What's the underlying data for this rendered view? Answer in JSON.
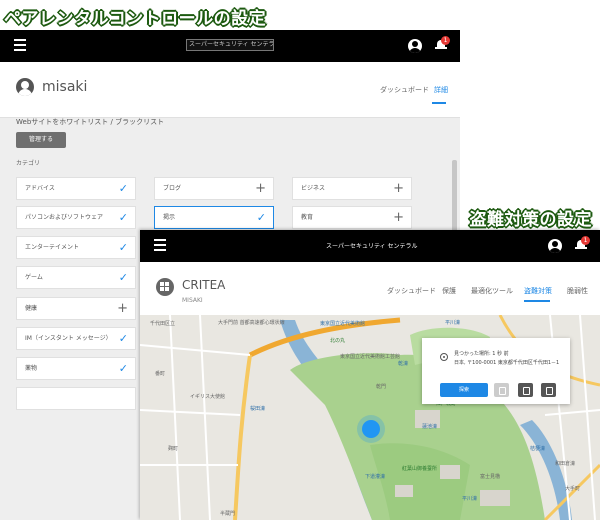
{
  "captions": {
    "parental": "ペアレンタルコントロールの設定",
    "antitheft": "盗難対策の設定"
  },
  "screen1": {
    "logo_alt": "スーパーセキュリティ センテラ",
    "notification_count": "1",
    "user_name": "misaki",
    "tabs": [
      "ダッシュボード",
      "詳細"
    ],
    "website_line": "Webサイトをホワイトリスト / ブラックリスト",
    "manage_button": "管理する",
    "section_label": "カテゴリ",
    "categories_col1": [
      {
        "label": "アドバイス",
        "mark": "check"
      },
      {
        "label": "パソコンおよびソフトウェア",
        "mark": "check"
      },
      {
        "label": "エンターテイメント",
        "mark": "check"
      },
      {
        "label": "ゲーム",
        "mark": "check"
      },
      {
        "label": "健康",
        "mark": "plus"
      },
      {
        "label": "IM（インスタント メッセージ）",
        "mark": "check"
      },
      {
        "label": "薬物",
        "mark": "check"
      }
    ],
    "categories_col2": [
      {
        "label": "ブログ",
        "mark": "plus"
      },
      {
        "label": "掲示",
        "mark": "check"
      }
    ],
    "categories_col3": [
      {
        "label": "ビジネス",
        "mark": "plus"
      },
      {
        "label": "教育",
        "mark": "plus"
      }
    ]
  },
  "screen2": {
    "app_title": "スーパーセキュリティ センテラル",
    "notification_count": "1",
    "device_name": "CRITEA",
    "device_user": "MISAKI",
    "tabs": [
      "ダッシュボード",
      "保護",
      "最適化ツール",
      "盗難対策",
      "脆弱性"
    ],
    "found_text": "見つかった場所: 1 秒 前",
    "address": "日本, 〒100-0001 東京都千代田区千代田1－1",
    "find_button": "探索",
    "map_labels": {
      "l1": "大手門前 首都高速都心環状線",
      "l2": "東京国立近代美術館",
      "l3": "北の丸",
      "l4": "乾濠",
      "l5": "平川濠",
      "l6": "江戸城跡",
      "l7": "千代田区立",
      "l8": "桜田濠",
      "l9": "蓮池濠",
      "l10": "下道灌濠",
      "l11": "紅葉山御養蚕所",
      "l12": "東京国立近代美術館工芸館",
      "l13": "イギリス大使館",
      "l14": "半蔵門",
      "l15": "桔梗濠",
      "l16": "和田倉濠",
      "l17": "大手町",
      "l18": "平川濠",
      "l19": "番町",
      "l20": "麹町",
      "l21": "乾門",
      "l22": "富士見櫓"
    }
  }
}
